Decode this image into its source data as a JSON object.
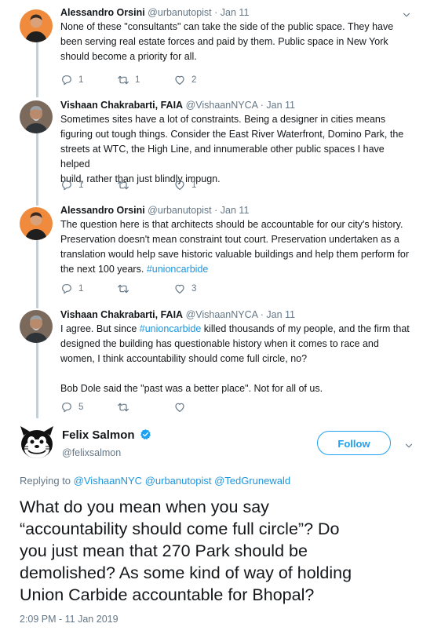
{
  "colors": {
    "accent": "#1da1f2",
    "link": "#1b95e0",
    "muted": "#657786",
    "thread_line": "#c4cfd6"
  },
  "replies": [
    {
      "name": "Alessandro Orsini",
      "handle": "@urbanutopist",
      "date": "· Jan 11",
      "lines": [
        "None of these \"consultants\" can take the side of the public space. They have",
        "been serving real estate forces and paid by them. Public space in New York",
        "should become a priority for all."
      ],
      "reply_count": "1",
      "retweet_count": "1",
      "like_count": "2"
    },
    {
      "name": "Vishaan Chakrabarti, FAIA",
      "handle": "@VishaanNYCA",
      "date": "· Jan 11",
      "lines": [
        "Sometimes sites have a lot of constraints. Being a designer in cities means",
        "figuring out tough things. Consider the East River Waterfront,  Domino Park, the",
        "streets at WTC, the High Line, and innumerable other public spaces I have helped",
        "build, rather than just blindly impugn."
      ],
      "reply_count": "1",
      "retweet_count": "",
      "like_count": "1"
    },
    {
      "name": "Alessandro Orsini",
      "handle": "@urbanutopist",
      "date": "· Jan 11",
      "lines": [
        "The question here is that architects should be accountable for our city's history.",
        "Preservation doesn't mean constraint tout court. Preservation undertaken as a",
        "translation would help save historic valuable buildings and help them perform for",
        "the next 100 years."
      ],
      "hashtag": "#unioncarbide",
      "reply_count": "1",
      "retweet_count": "",
      "like_count": "3"
    },
    {
      "name": "Vishaan Chakrabarti, FAIA",
      "handle": "@VishaanNYCA",
      "date": "· Jan 11",
      "line1_pre": "I agree. But since ",
      "line1_tag": "#unioncarbide",
      "line1_post": " killed thousands of my people, and the firm that",
      "lines": [
        "designed the building has questionable history when it comes to race and",
        "women, I think accountability should come full circle, no?"
      ],
      "para2": "Bob Dole said the \"past was a better place\". Not for all of us.",
      "reply_count": "5",
      "retweet_count": "",
      "like_count": ""
    }
  ],
  "focal": {
    "name": "Felix Salmon",
    "handle": "@felixsalmon",
    "follow_label": "Follow",
    "replying_prefix": "Replying to",
    "replying_to": [
      "@VishaanNYC",
      "@urbanutopist",
      "@TedGrunewald"
    ],
    "text_lines": [
      "What do you mean when you say",
      "“accountability should come full circle”? Do",
      "you just mean that 270 Park should be",
      "demolished? As some kind of way of holding",
      "Union Carbide accountable for Bhopal?"
    ],
    "timestamp": "2:09 PM - 11 Jan 2019"
  }
}
